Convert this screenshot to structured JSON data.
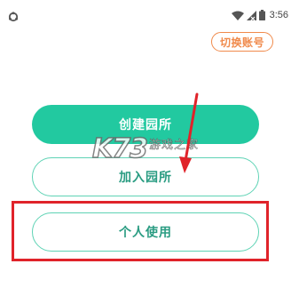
{
  "status_bar": {
    "time": "3:56",
    "app_icon": "sync-circle-icon",
    "icons": [
      "wifi-icon",
      "signal-icon",
      "battery-icon"
    ]
  },
  "header": {
    "switch_account_label": "切换账号"
  },
  "actions": {
    "create_label": "创建园所",
    "join_label": "加入园所",
    "personal_label": "个人使用"
  },
  "watermark": {
    "logo_text": "K73",
    "site_text": "游戏之家"
  },
  "colors": {
    "primary": "#22c9a0",
    "outline": "#5fd3b5",
    "accent_orange": "#f08a4b",
    "annotation_red": "#e0232a"
  }
}
